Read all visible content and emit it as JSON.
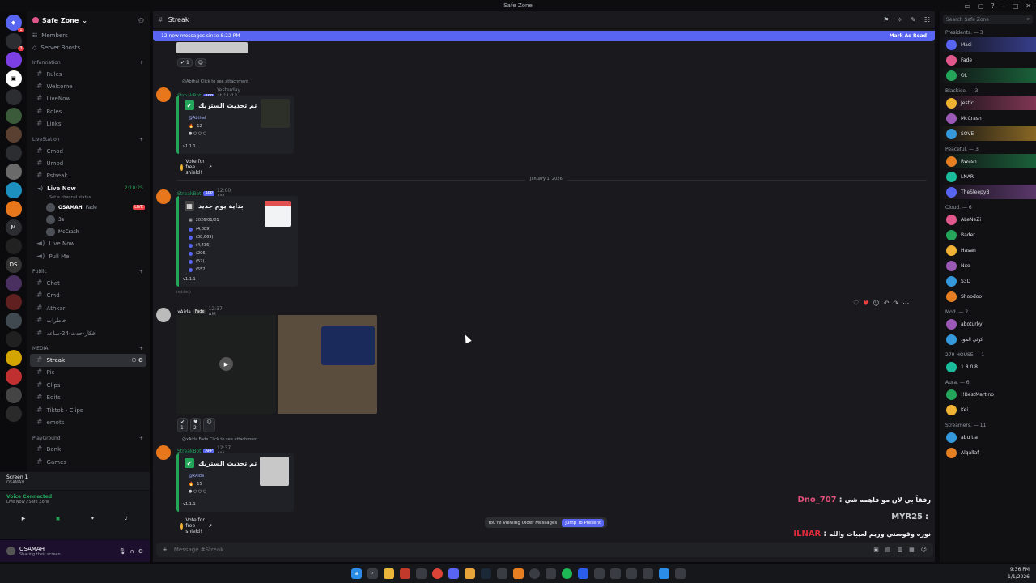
{
  "window": {
    "title": "Safe Zone"
  },
  "server": {
    "name": "Safe Zone"
  },
  "nav": {
    "members": "Members",
    "boosts": "Server Boosts"
  },
  "categories": {
    "information": "Information",
    "livestation": "LiveStation",
    "public": "Public",
    "media": "MEDIA",
    "playground": "PlayGround"
  },
  "channels": {
    "info": [
      "Rules",
      "Welcome",
      "LiveNow",
      "Roles",
      "Links"
    ],
    "live": [
      "Cmod",
      "Umod",
      "Pstreak"
    ],
    "voice_live": {
      "name": "Live Now",
      "timer": "2:10:25",
      "status": "Set a channel status"
    },
    "voice_users": [
      {
        "name": "OSAMAH",
        "tag": "Fade",
        "live": "LIVE"
      },
      {
        "name": "3s"
      },
      {
        "name": "McCrash"
      }
    ],
    "more_live": [
      "Live Now",
      "Pull Me"
    ],
    "public": [
      "Chat",
      "Cmd",
      "Athkar",
      "خاطرات",
      "افكار-حدث-24-ساعه"
    ],
    "media": [
      "Streak",
      "Pic",
      "Clips",
      "Edits",
      "Tiktok - Clips",
      "emots"
    ],
    "playground": [
      "Bank",
      "Games"
    ]
  },
  "screen_panel": {
    "title": "Screen 1",
    "sub": "OSAMAH"
  },
  "voice_panel": {
    "title": "Voice Connected",
    "sub": "Live Now / Safe Zone"
  },
  "user_panel": {
    "name": "OSAMAH",
    "status": "Sharing their screen"
  },
  "chat": {
    "channel": "Streak",
    "new_messages": "12 new messages since 8:22 PM",
    "mark_read": "Mark As Read",
    "date_divider": "January 1, 2026",
    "viewing_older": "You're Viewing Older Messages",
    "jump": "Jump To Present",
    "composer_placeholder": "Message #Streak"
  },
  "messages": [
    {
      "reply": "@Abthal Click to see attachment",
      "author": "StreakBot",
      "app": "APP",
      "time": "Yesterday at 11:13 PM",
      "title": "تم تحديث الستريك",
      "mention": "@Abthal",
      "count": "12",
      "footer": "v1.1.1",
      "vote": "Vote for free shield!"
    },
    {
      "author": "StreakBot",
      "app": "APP",
      "time": "12:00 AM",
      "title": "بداية يوم جديد",
      "date": "2026/01/01",
      "lines": [
        "(4,889)",
        "(38,669)",
        "(4,436)",
        "(206)",
        "(52)",
        "(552)"
      ],
      "footer": "v1.1.1",
      "edited": "(edited)"
    },
    {
      "author": "xAida",
      "tag": "Fade",
      "time": "12:37 AM",
      "reacts": [
        "1",
        "2"
      ]
    },
    {
      "reply": "@xAida Fade Click to see attachment",
      "author": "StreakBot",
      "app": "APP",
      "time": "12:37 AM",
      "title": "تم تحديث الستريك",
      "mention": "@xAida",
      "count": "15",
      "footer": "v1.1.1",
      "vote": "Vote for free shield!"
    }
  ],
  "top_reacts": [
    "1"
  ],
  "members": {
    "search": "Search Safe Zone",
    "groups": [
      {
        "title": "Presidents. — 3",
        "list": [
          "Masi",
          "Fade",
          "OL"
        ]
      },
      {
        "title": "Blackice. — 3",
        "list": [
          "Jestic",
          "McCrash",
          "SOVE"
        ]
      },
      {
        "title": "Peaceful. — 3",
        "list": [
          "Rwash",
          "LNAR",
          "TheSleepyB"
        ]
      },
      {
        "title": "Cloud. — 6",
        "list": [
          "ALeNeZi",
          "Bader.",
          "Hasan",
          "Nxe",
          "S3D",
          "Shoodoo"
        ]
      },
      {
        "title": "Mod. — 2",
        "list": [
          "aboturky",
          "كوتي المود"
        ]
      },
      {
        "title": "279 HOUSE — 1",
        "list": [
          "1.8.0.8"
        ]
      },
      {
        "title": "Aura. — 6",
        "list": [
          "!!BestMartino",
          "Kei"
        ]
      },
      {
        "title": "Streamers. — 11",
        "list": [
          "abu tia",
          "Alqallaf"
        ]
      }
    ]
  },
  "overlay": [
    {
      "name": "Dno_707",
      "text": "رفقاً بي لان مو فاهمه شي",
      "color": "#e0507a"
    },
    {
      "name": "MYR25",
      "text": "",
      "color": "#c9ccd1"
    },
    {
      "name": "ILNAR",
      "text": "نوره وقوستي وريم لعيبات والله",
      "color": "#e02a3a"
    }
  ],
  "clock": {
    "time": "9:36 PM",
    "date": "1/1/2026"
  },
  "colors": {
    "accent": "#5865f2",
    "green": "#23a55a",
    "live": "#f23f43",
    "bot": "#1fa05f"
  }
}
